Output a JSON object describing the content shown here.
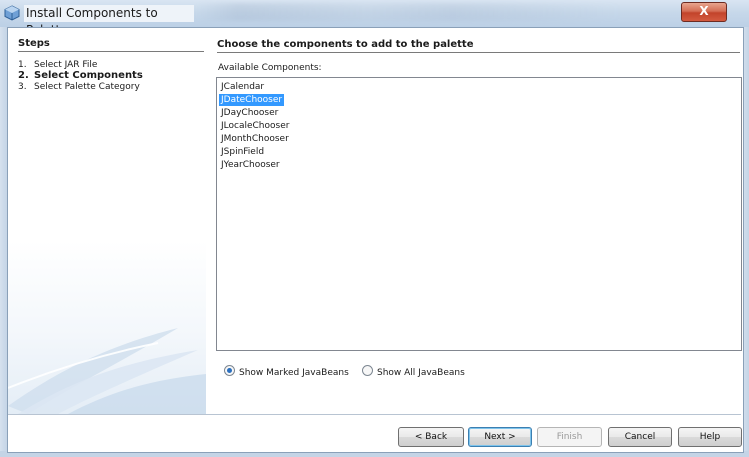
{
  "window": {
    "title": "Install Components to Palette",
    "close_label": "X"
  },
  "steps": {
    "heading": "Steps",
    "items": [
      {
        "num": "1.",
        "label": "Select JAR File",
        "current": false
      },
      {
        "num": "2.",
        "label": "Select Components",
        "current": true
      },
      {
        "num": "3.",
        "label": "Select Palette Category",
        "current": false
      }
    ]
  },
  "main": {
    "heading": "Choose the components to add to the palette",
    "list_label": "Available Components:",
    "components": [
      {
        "label": "JCalendar",
        "selected": false
      },
      {
        "label": "JDateChooser",
        "selected": true
      },
      {
        "label": "JDayChooser",
        "selected": false
      },
      {
        "label": "JLocaleChooser",
        "selected": false
      },
      {
        "label": "JMonthChooser",
        "selected": false
      },
      {
        "label": "JSpinField",
        "selected": false
      },
      {
        "label": "JYearChooser",
        "selected": false
      }
    ],
    "radios": {
      "marked_label": "Show Marked JavaBeans",
      "all_label": "Show All JavaBeans",
      "selected": "marked"
    }
  },
  "buttons": {
    "back": "< Back",
    "next": "Next >",
    "finish": "Finish",
    "cancel": "Cancel",
    "help": "Help"
  },
  "colors": {
    "selection": "#3399ff",
    "close_button": "#c2432b"
  }
}
